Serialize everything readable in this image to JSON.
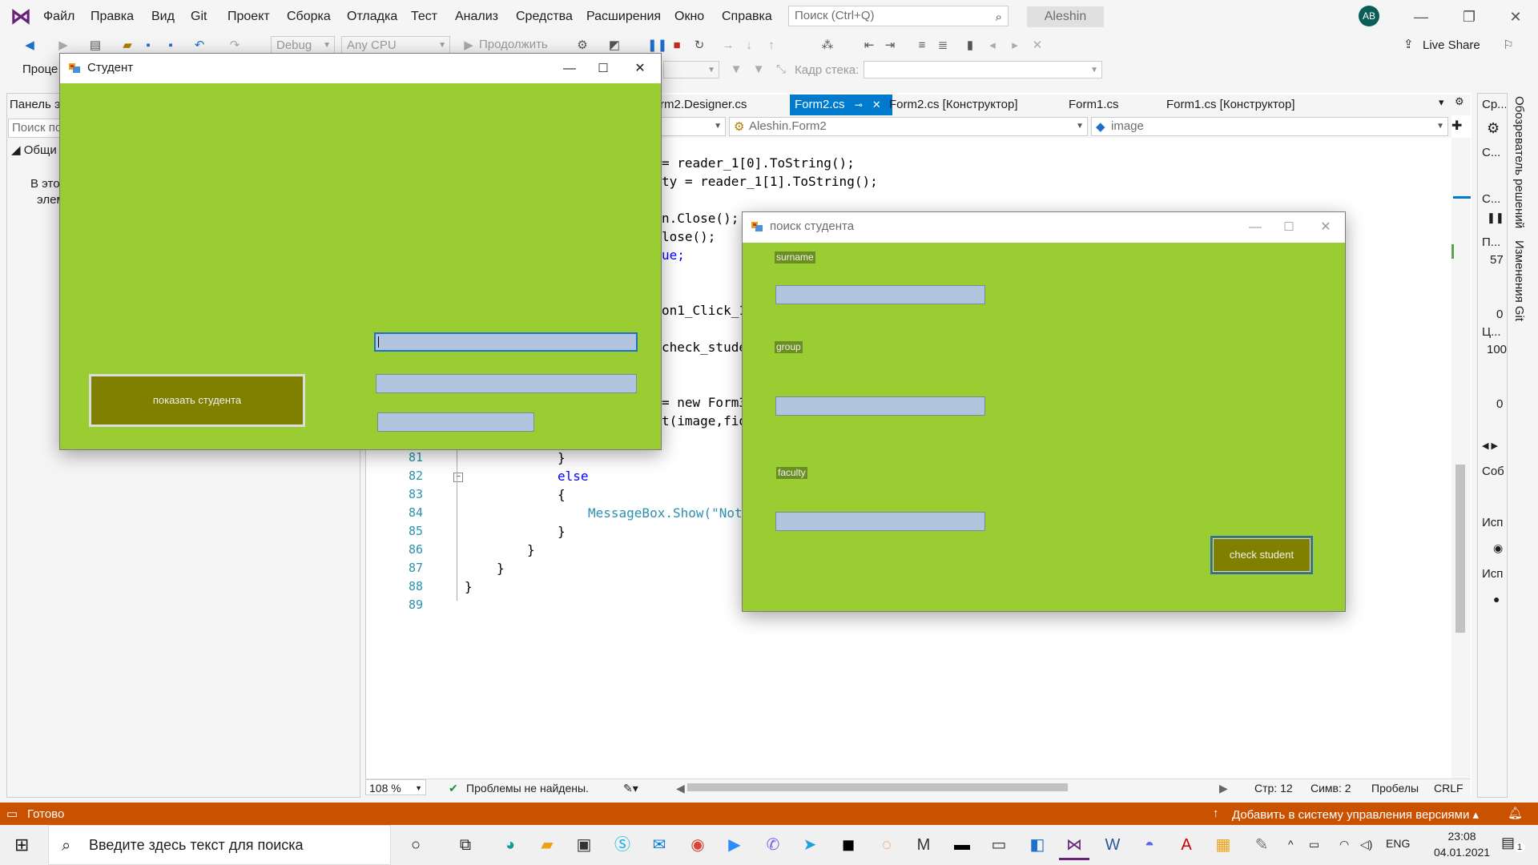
{
  "ide": {
    "menu": [
      "Файл",
      "Правка",
      "Вид",
      "Git",
      "Проект",
      "Сборка",
      "Отладка",
      "Тест",
      "Анализ",
      "Средства",
      "Расширения",
      "Окно",
      "Справка"
    ],
    "search_placeholder": "Поиск (Ctrl+Q)",
    "solution_name": "Aleshin",
    "avatar_initials": "AB",
    "toolbar": {
      "config": "Debug",
      "platform": "Any CPU",
      "continue_label": "Продолжить",
      "live_share": "Live Share",
      "process_label": "Проце",
      "stack_frame_label": "Кадр стека:"
    },
    "toolbox": {
      "title": "Панель э",
      "search_placeholder": "Поиск по",
      "group": "Общи",
      "empty_text_1": "В это",
      "empty_text_2": "элем"
    },
    "tabs": [
      "Form2.Designer.cs",
      "Form2.cs",
      "Form2.cs [Конструктор]",
      "Form1.cs",
      "Form1.cs [Конструктор]"
    ],
    "tab_prefix_partial": "rm2.Designer.cs",
    "nav": {
      "class": "Aleshin.Form2",
      "member": "image"
    },
    "code": {
      "line_numbers": [
        "81",
        "82",
        "83",
        "84",
        "85",
        "86",
        "87",
        "88",
        "89"
      ],
      "partial_lines": [
        "= reader_1[0].ToString();",
        "ty = reader_1[1].ToString();",
        "n.Close();",
        "lose();",
        "ue;",
        "on1_Click_1",
        "check_stude",
        "= new Form3",
        "t(image,fio",
        ";"
      ],
      "else": "else",
      "msg_call": "MessageBox.Show(\"Not",
      "brace_open": "{",
      "brace_close": "}"
    },
    "code_status": {
      "zoom": "108 %",
      "problems": "Проблемы не найдены.",
      "line": "Стр: 12",
      "col": "Симв: 2",
      "indent": "Пробелы",
      "eol": "CRLF"
    },
    "right_panel": [
      "Ср...",
      "С...",
      "С...",
      "П...",
      "57",
      "0",
      "Ц...",
      "100",
      "0",
      "Соб",
      "Исп",
      "Исп"
    ],
    "vertical_tabs": [
      "Обозреватель решений",
      "Изменения Git"
    ],
    "status": {
      "ready": "Готово",
      "vcs": "Добавить в систему управления версиями"
    }
  },
  "form_student": {
    "title": "Студент",
    "button": "показать студента"
  },
  "form_search": {
    "title": "поиск студента",
    "label_surname": "surname",
    "label_group": "group",
    "label_faculty": "faculty",
    "button": "check student"
  },
  "taskbar": {
    "search_placeholder": "Введите здесь текст для поиска",
    "lang": "ENG",
    "time": "23:08",
    "date": "04.01.2021",
    "notif_count": "1"
  },
  "colors": {
    "form_back": "#9acd32",
    "button_back": "#808000",
    "input_back": "#b0c4de",
    "label_back": "#6b8e23",
    "status_bar": "#ca5100",
    "accent": "#007acc"
  }
}
